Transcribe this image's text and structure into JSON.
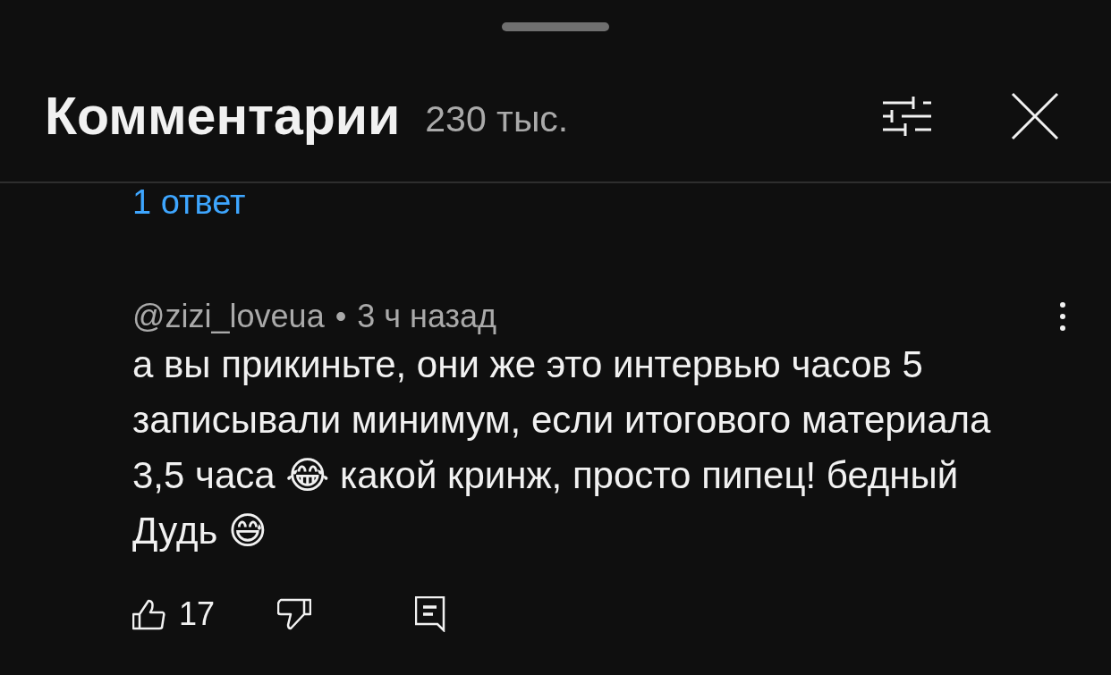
{
  "panel": {
    "title": "Комментарии",
    "count": "230 тыс."
  },
  "previous_reply_link": "1 ответ",
  "comment": {
    "author": "@zizi_loveua",
    "separator": "•",
    "time": "3 ч назад",
    "text": "а вы прикиньте, они же это интервью часов 5 записывали минимум, если итогового материала 3,5 часа 😂 какой кринж, просто пипец! бедный Дудь 😅",
    "likes": "17"
  }
}
